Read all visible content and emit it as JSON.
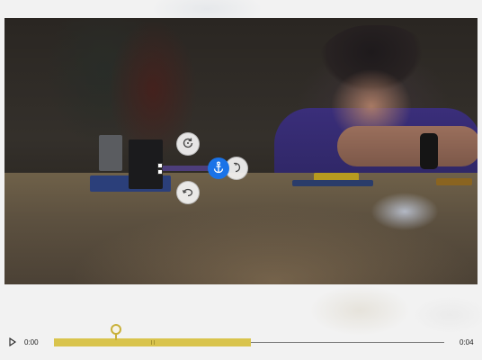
{
  "player": {
    "play_icon": "play-icon",
    "current_time": "0:00",
    "duration": "0:04",
    "selection_fraction": 0.505,
    "playhead_fraction": 0.16
  },
  "overlay": {
    "icons": {
      "rotate_top": "rotate-icon",
      "anchor": "anchor-icon",
      "rotate_right": "rotate-icon",
      "rotate_bottom": "rotate-icon"
    },
    "colors": {
      "anchor": "#1a73e8",
      "timeline_fill": "#d9c44d"
    }
  }
}
